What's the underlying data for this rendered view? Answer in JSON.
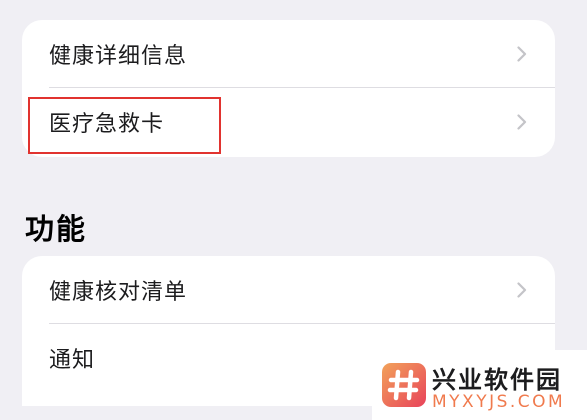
{
  "groups": {
    "top": {
      "items": [
        {
          "label": "健康详细信息",
          "icon": "chevron-right-icon"
        },
        {
          "label": "医疗急救卡",
          "icon": "chevron-right-icon",
          "highlighted": true
        }
      ]
    },
    "features": {
      "header": "功能",
      "items": [
        {
          "label": "健康核对清单",
          "icon": "chevron-right-icon"
        },
        {
          "label": "通知"
        }
      ]
    }
  },
  "watermark": {
    "title": "兴业软件园",
    "url": "MYXYJS.COM",
    "logo": "hash-logo"
  },
  "colors": {
    "background": "#f0eff4",
    "card": "#ffffff",
    "text": "#1c1c1e",
    "chevron": "#c4c4c8",
    "highlight_border": "#e1332f",
    "watermark_accent": "#f07a4d"
  }
}
